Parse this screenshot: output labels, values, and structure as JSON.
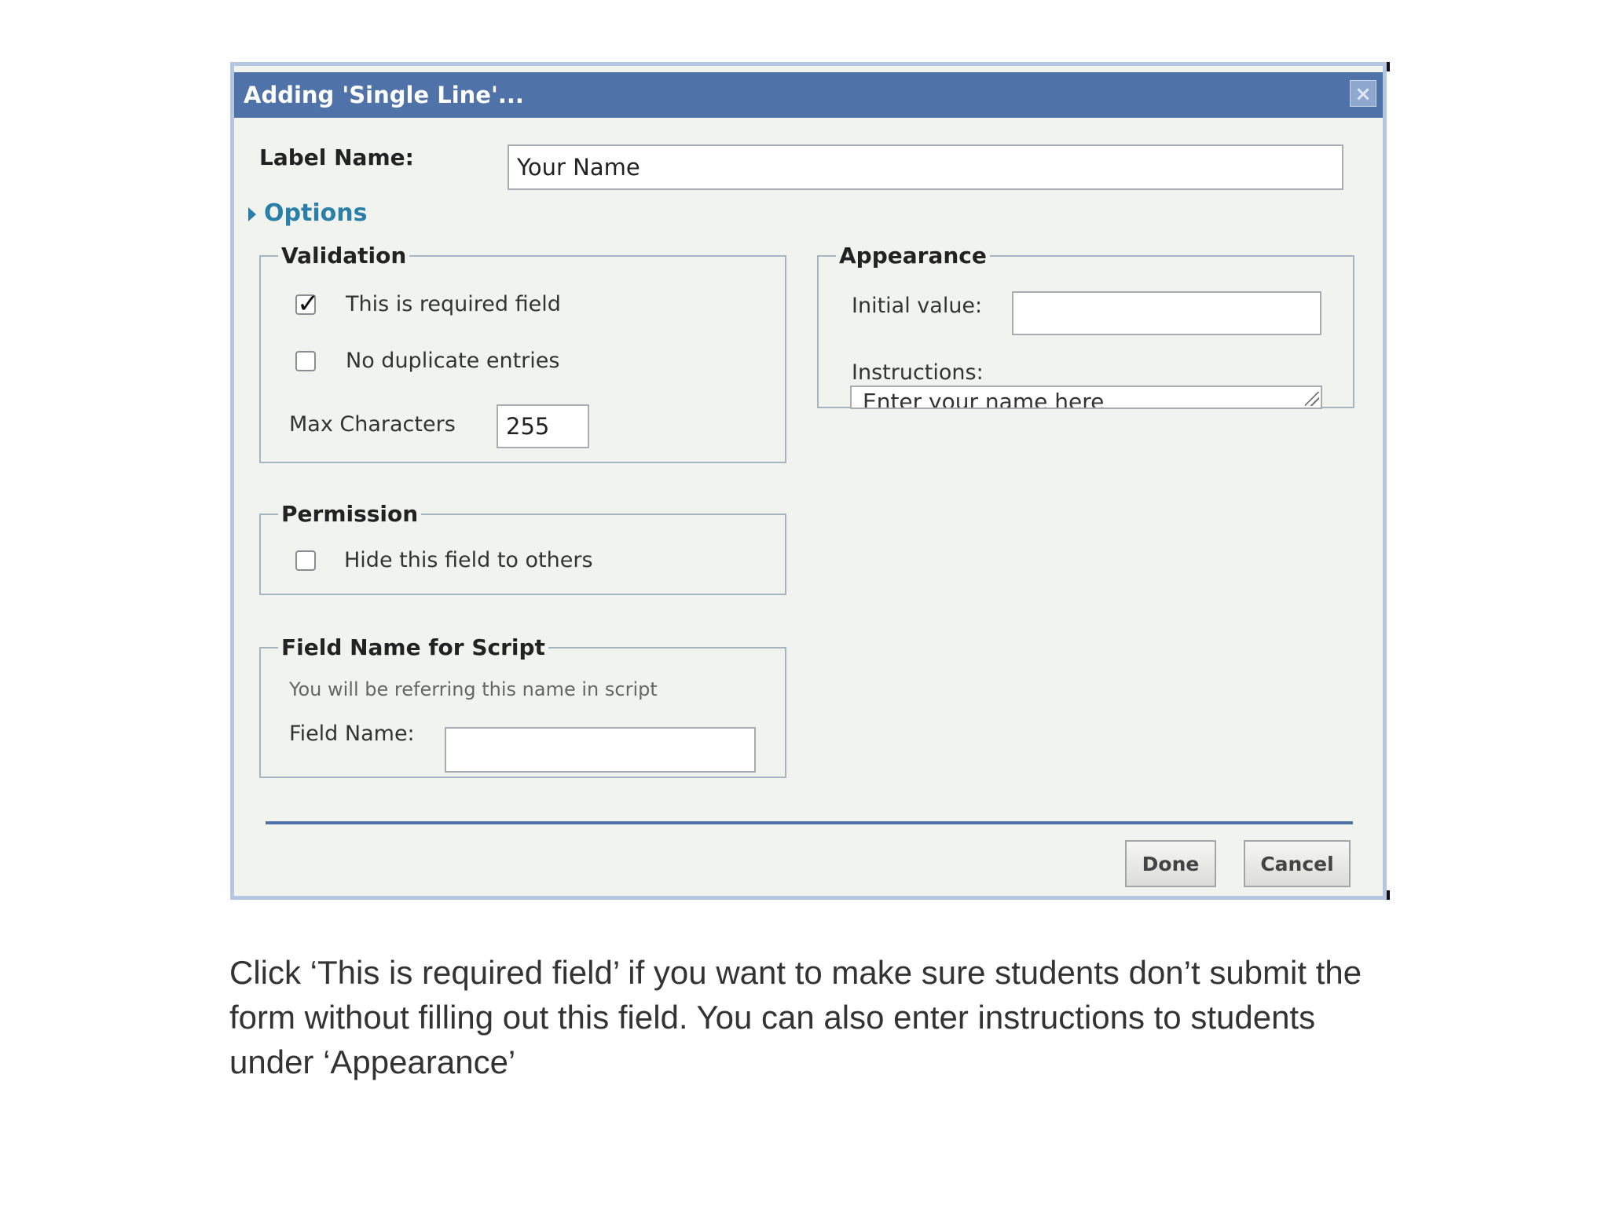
{
  "dialog": {
    "title": "Adding 'Single Line'...",
    "close_glyph": "×",
    "label_name_label": "Label Name:",
    "label_name_value": "Your Name",
    "options_label": "Options",
    "validation": {
      "legend": "Validation",
      "required_label": "This is required field",
      "required_checked": true,
      "no_duplicate_label": "No duplicate entries",
      "no_duplicate_checked": false,
      "max_chars_label": "Max Characters",
      "max_chars_value": "255"
    },
    "permission": {
      "legend": "Permission",
      "hide_label": "Hide this field to others",
      "hide_checked": false
    },
    "script_field": {
      "legend": "Field Name for Script",
      "hint": "You will be referring this name in script",
      "field_name_label": "Field Name:",
      "field_name_value": ""
    },
    "appearance": {
      "legend": "Appearance",
      "initial_value_label": "Initial value:",
      "initial_value": "",
      "instructions_label": "Instructions:",
      "instructions_value": "Enter your name here"
    },
    "buttons": {
      "done": "Done",
      "cancel": "Cancel"
    }
  },
  "caption": "Click ‘This is required field’ if you want to make sure students don’t submit the form without filling out this field. You can also enter instructions to students under ‘Appearance’",
  "colors": {
    "titlebar": "#4f72a9",
    "panel": "#f1f4ee",
    "options_link": "#2a7fa8"
  },
  "icons": {
    "close": "close-icon",
    "options_toggle": "triangle-right-icon",
    "check": "checkmark-icon"
  }
}
